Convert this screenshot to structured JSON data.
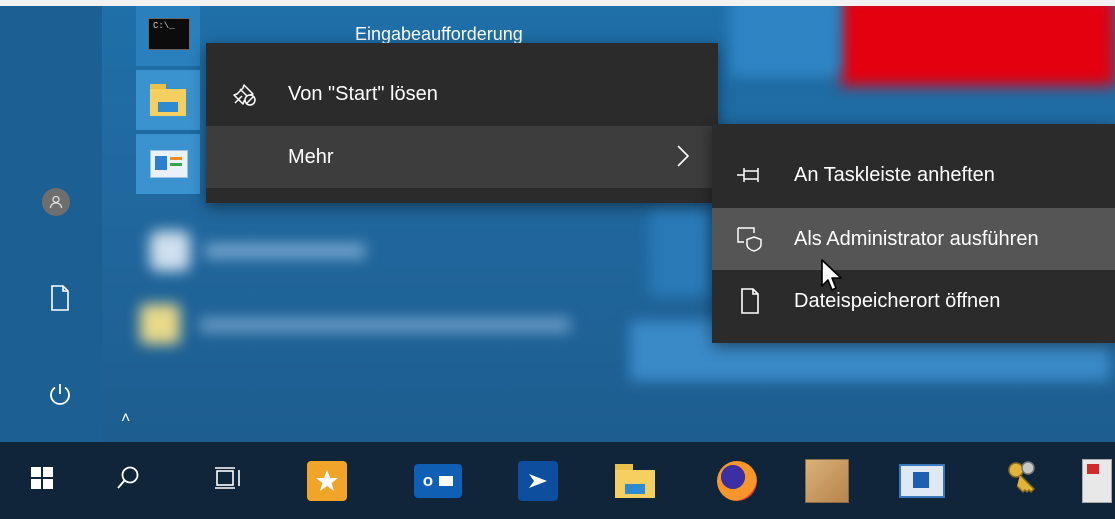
{
  "start_menu": {
    "tile_label": "Eingabeaufforderung"
  },
  "context_menu": {
    "items": [
      {
        "label": "Von \"Start\" lösen",
        "icon": "unpin-icon"
      },
      {
        "label": "Mehr",
        "icon": "chevron-right-icon"
      }
    ]
  },
  "submenu": {
    "items": [
      {
        "label": "An Taskleiste anheften",
        "icon": "pin-icon"
      },
      {
        "label": "Als Administrator ausführen",
        "icon": "admin-shield-icon"
      },
      {
        "label": "Dateispeicherort öffnen",
        "icon": "file-icon"
      }
    ]
  },
  "taskbar": {
    "outlook_letter": "o",
    "icons": [
      "windows-start-icon",
      "search-icon",
      "task-view-icon",
      "app-icon",
      "outlook-icon",
      "app-icon",
      "file-explorer-icon",
      "firefox-icon",
      "app-icon",
      "app-icon",
      "keys-icon",
      "app-icon"
    ]
  },
  "colors": {
    "menu_bg": "#2b2b2b",
    "menu_hover": "#3d3d3d",
    "submenu_hover": "#555555",
    "taskbar_bg": "#11253a",
    "accent_red": "#e3000f"
  }
}
